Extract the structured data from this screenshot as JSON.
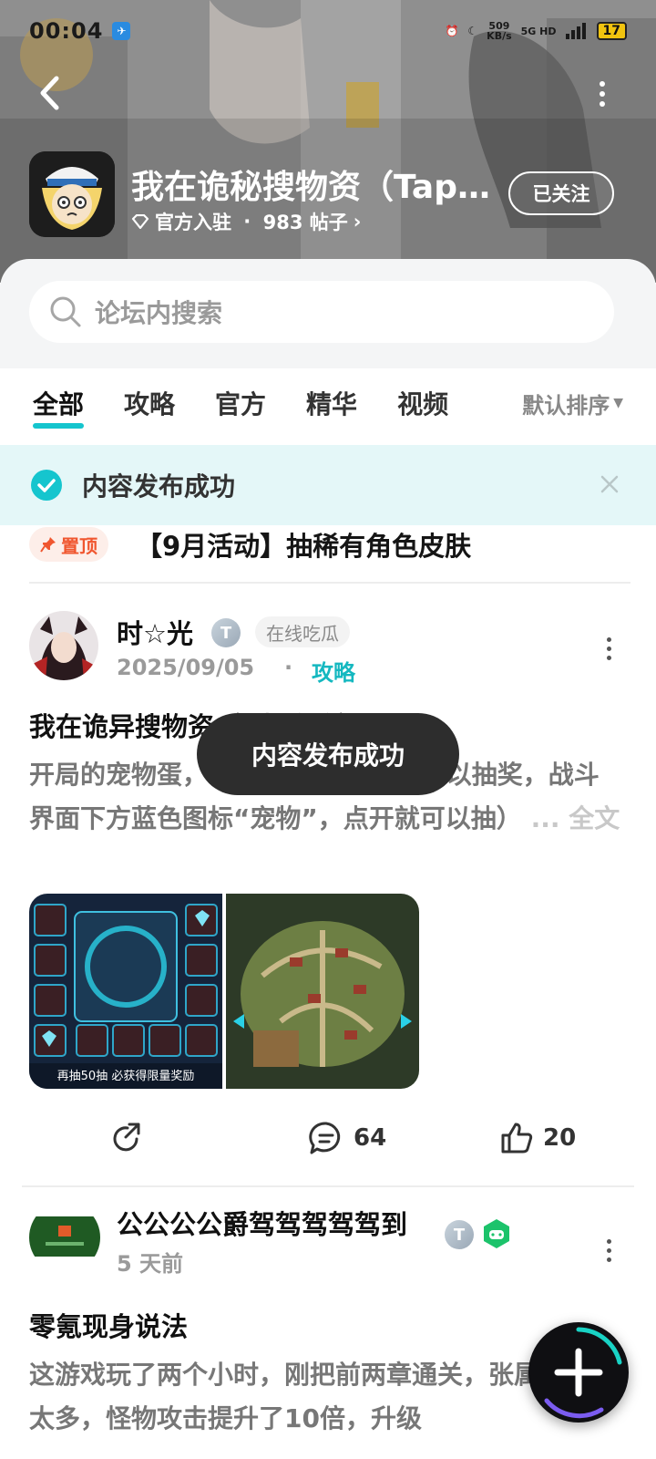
{
  "status_bar": {
    "time": "00:04",
    "net_speed_value": "509",
    "net_speed_unit": "KB/s",
    "network": "5G HD",
    "battery": "17"
  },
  "header": {
    "app_title": "我在诡秘搜物资（Tap…",
    "official_label": "官方入驻",
    "post_count": "983 帖子",
    "follow_label": "已关注"
  },
  "search": {
    "placeholder": "论坛内搜索"
  },
  "tabs": [
    "全部",
    "攻略",
    "官方",
    "精华",
    "视频"
  ],
  "sort_label": "默认排序",
  "banner": {
    "text": "内容发布成功"
  },
  "pinned": {
    "badge": "置顶",
    "title": "【9月活动】抽稀有角色皮肤"
  },
  "posts": [
    {
      "username": "时☆光",
      "level_badge": "T",
      "tag": "在线吃瓜",
      "date": "2025/09/05",
      "category": "攻略",
      "title": "我在诡异搜物资（9版攻略）",
      "body": "开局的宠物蛋，          （要打过几章节才可以抽奖，战斗界面下方蓝色图标“宠物”，点开就可以抽）",
      "fulltext": "... 全文",
      "comments": "64",
      "likes": "20",
      "image_1_caption": "再抽50抽 必获得限量奖励"
    },
    {
      "username": "公公公公爵驾驾驾驾驾到",
      "level_badge": "T",
      "date": "5 天前",
      "title": "零氪现身说法",
      "body": "这游戏玩了两个小时，刚把前两章通关，张属性提升太多，怪物攻击提升了10倍，升级"
    }
  ],
  "toast": {
    "text": "内容发布成功"
  },
  "colors": {
    "accent": "#15c5ce",
    "pin": "#f0562f",
    "banner_bg": "#e4f7f8"
  }
}
